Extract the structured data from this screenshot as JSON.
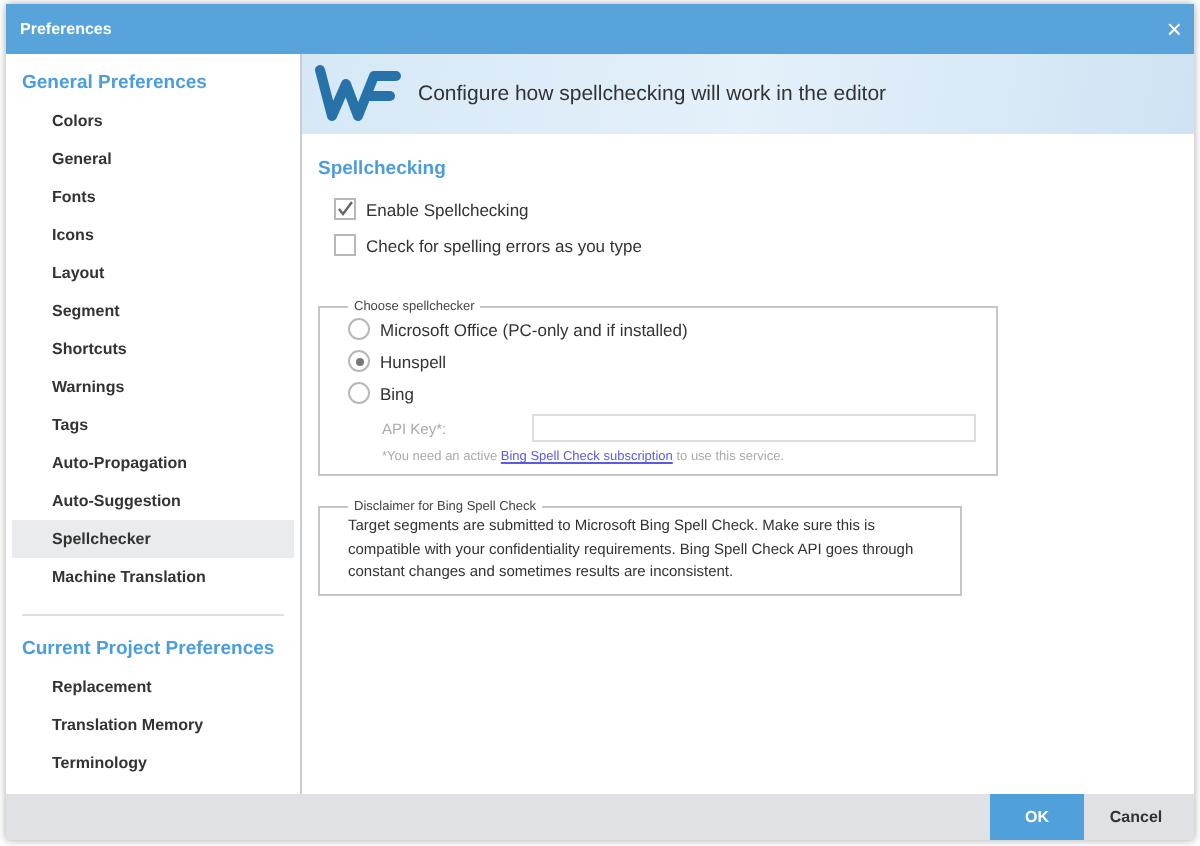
{
  "window": {
    "title": "Preferences",
    "close": "×"
  },
  "sidebar": {
    "sections": [
      {
        "heading": "General Preferences",
        "items": [
          {
            "label": "Colors",
            "selected": false
          },
          {
            "label": "General",
            "selected": false
          },
          {
            "label": "Fonts",
            "selected": false
          },
          {
            "label": "Icons",
            "selected": false
          },
          {
            "label": "Layout",
            "selected": false
          },
          {
            "label": "Segment",
            "selected": false
          },
          {
            "label": "Shortcuts",
            "selected": false
          },
          {
            "label": "Warnings",
            "selected": false
          },
          {
            "label": "Tags",
            "selected": false
          },
          {
            "label": "Auto-Propagation",
            "selected": false
          },
          {
            "label": "Auto-Suggestion",
            "selected": false
          },
          {
            "label": "Spellchecker",
            "selected": true
          },
          {
            "label": "Machine Translation",
            "selected": false
          }
        ]
      },
      {
        "heading": "Current Project Preferences",
        "items": [
          {
            "label": "Replacement",
            "selected": false
          },
          {
            "label": "Translation Memory",
            "selected": false
          },
          {
            "label": "Terminology",
            "selected": false
          }
        ]
      }
    ]
  },
  "banner": {
    "text": "Configure how spellchecking will work in the editor"
  },
  "section_title": "Spellchecking",
  "checkboxes": [
    {
      "label": "Enable Spellchecking",
      "checked": true
    },
    {
      "label": "Check for spelling errors as you type",
      "checked": false
    }
  ],
  "spellchecker_group": {
    "legend": "Choose spellchecker",
    "options": [
      {
        "label": "Microsoft Office (PC-only and if installed)",
        "selected": false
      },
      {
        "label": "Hunspell",
        "selected": true
      },
      {
        "label": "Bing",
        "selected": false
      }
    ],
    "api_key_label": "API Key*:",
    "note": {
      "before": "*You need an active ",
      "link": "Bing Spell Check subscription",
      "after": " to use this service."
    }
  },
  "disclaimer": {
    "legend": "Disclaimer for Bing Spell Check",
    "text": "Target segments are submitted to Microsoft Bing Spell Check. Make sure this is compatible with your confidentiality requirements. Bing Spell Check API goes through constant changes and sometimes results are inconsistent."
  },
  "buttons": [
    {
      "label": "OK",
      "kind": "primary"
    },
    {
      "label": "Cancel",
      "kind": "secondary"
    }
  ]
}
